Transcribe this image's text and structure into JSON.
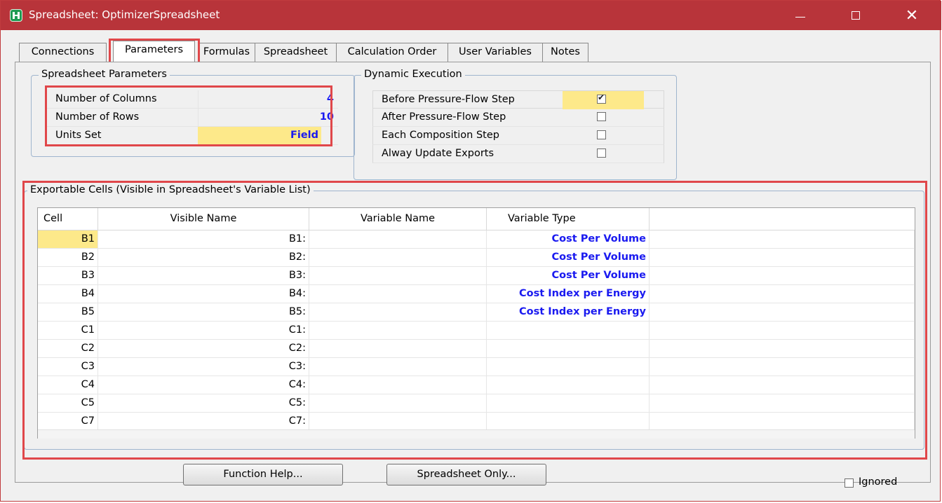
{
  "window": {
    "title": "Spreadsheet: OptimizerSpreadsheet",
    "minimize_glyph": "—",
    "maximize_glyph": "☐",
    "close_glyph": "✕"
  },
  "tabs": [
    {
      "label": "Connections"
    },
    {
      "label": "Parameters",
      "active": true
    },
    {
      "label": "Formulas"
    },
    {
      "label": "Spreadsheet"
    },
    {
      "label": "Calculation Order"
    },
    {
      "label": "User Variables"
    },
    {
      "label": "Notes"
    }
  ],
  "spreadsheet_parameters": {
    "title": "Spreadsheet Parameters",
    "rows": [
      {
        "label": "Number of Columns",
        "value": "4"
      },
      {
        "label": "Number of Rows",
        "value": "10"
      },
      {
        "label": "Units Set",
        "value": "Field"
      }
    ]
  },
  "dynamic_execution": {
    "title": "Dynamic Execution",
    "rows": [
      {
        "label": "Before Pressure-Flow Step",
        "checked": true
      },
      {
        "label": "After Pressure-Flow Step",
        "checked": false
      },
      {
        "label": "Each Composition Step",
        "checked": false
      },
      {
        "label": "Alway Update Exports",
        "checked": false
      }
    ]
  },
  "exportable_cells": {
    "title": "Exportable Cells (Visible in Spreadsheet's Variable List)",
    "columns": [
      "Cell",
      "Visible Name",
      "Variable Name",
      "Variable Type"
    ],
    "rows": [
      {
        "cell": "B1",
        "visible_name": "B1:",
        "variable_name": "",
        "variable_type": "Cost Per Volume"
      },
      {
        "cell": "B2",
        "visible_name": "B2:",
        "variable_name": "",
        "variable_type": "Cost Per Volume"
      },
      {
        "cell": "B3",
        "visible_name": "B3:",
        "variable_name": "",
        "variable_type": "Cost Per Volume"
      },
      {
        "cell": "B4",
        "visible_name": "B4:",
        "variable_name": "",
        "variable_type": "Cost Index per Energy"
      },
      {
        "cell": "B5",
        "visible_name": "B5:",
        "variable_name": "",
        "variable_type": "Cost Index per Energy"
      },
      {
        "cell": "C1",
        "visible_name": "C1:",
        "variable_name": "",
        "variable_type": ""
      },
      {
        "cell": "C2",
        "visible_name": "C2:",
        "variable_name": "",
        "variable_type": ""
      },
      {
        "cell": "C3",
        "visible_name": "C3:",
        "variable_name": "",
        "variable_type": ""
      },
      {
        "cell": "C4",
        "visible_name": "C4:",
        "variable_name": "",
        "variable_type": ""
      },
      {
        "cell": "C5",
        "visible_name": "C5:",
        "variable_name": "",
        "variable_type": ""
      },
      {
        "cell": "C7",
        "visible_name": "C7:",
        "variable_name": "",
        "variable_type": ""
      }
    ]
  },
  "buttons": {
    "function_help": "Function Help...",
    "spreadsheet_only": "Spreadsheet Only..."
  },
  "ignored": {
    "label": "Ignored",
    "checked": false
  },
  "colors": {
    "titlebar": "#b8343a",
    "highlight_border": "#e0474a",
    "value_blue": "#1a1af0",
    "selected_yellow": "#fde98a"
  }
}
